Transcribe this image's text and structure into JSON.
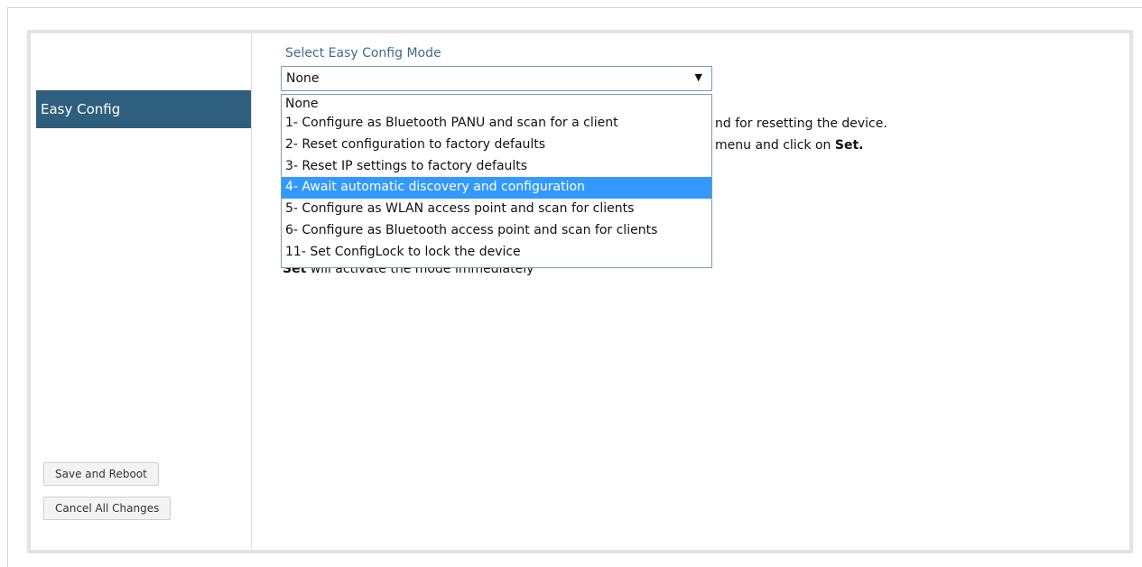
{
  "sidebar": {
    "items": [
      {
        "label": "Easy Config"
      }
    ],
    "save_label": "Save and Reboot",
    "cancel_label": "Cancel All Changes"
  },
  "main": {
    "select_label": "Select Easy Config Mode",
    "selected_value": "None",
    "description_line1": "nd for resetting the device.",
    "description_line2": "menu and click on",
    "description_line2_bold": "Set.",
    "partial_line_bold": "Set",
    "partial_line_rest": " will activate the mode immediately",
    "dropdown_options": [
      "None",
      "1- Configure as Bluetooth PANU and scan for a client",
      "2- Reset configuration to factory defaults",
      "3- Reset IP settings to factory defaults",
      "4- Await automatic discovery and configuration",
      "5- Configure as WLAN access point and scan for clients",
      "6- Configure as Bluetooth access point and scan for clients",
      "11- Set ConfigLock to lock the device"
    ],
    "highlighted_option": "4- Await automatic discovery and configuration"
  },
  "colors": {
    "sidebar_active": "#2f5f7e",
    "label_text": "#3b6c8c",
    "highlight": "#3399ff"
  },
  "icons": {
    "select_arrow": "dropdown-arrow-icon"
  }
}
